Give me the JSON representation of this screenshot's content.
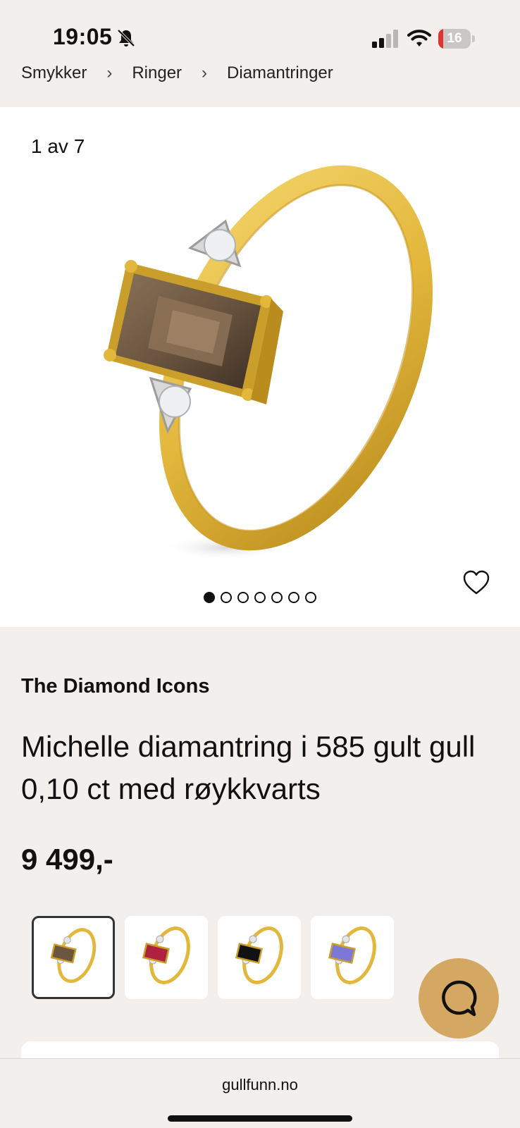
{
  "status_bar": {
    "time": "19:05",
    "battery_level": "16",
    "battery_fraction": 0.16,
    "icons": [
      "bell-slash-icon",
      "cellular-signal-icon",
      "wifi-icon",
      "battery-icon"
    ]
  },
  "breadcrumb": {
    "items": [
      "Smykker",
      "Ringer",
      "Diamantringer"
    ],
    "separator": "›"
  },
  "gallery": {
    "counter": "1 av 7",
    "total_images": 7,
    "active_index": 1,
    "favorite_icon": "heart-icon"
  },
  "product": {
    "brand": "The Diamond Icons",
    "title": "Michelle diamantring i 585 gult gull 0,10 ct med røykkvarts",
    "price": "9 499,-"
  },
  "variants": {
    "selected_index": 0,
    "stones": [
      "#6b5540",
      "#b0203f",
      "#121212",
      "#7c78d6"
    ]
  },
  "chat_button": {
    "icon": "chat-bubble-icon",
    "color": "#d4a862"
  },
  "browser": {
    "url": "gullfunn.no"
  },
  "colors": {
    "background": "#f2efed",
    "gold": "#e3b73c",
    "accent": "#d4a862"
  }
}
